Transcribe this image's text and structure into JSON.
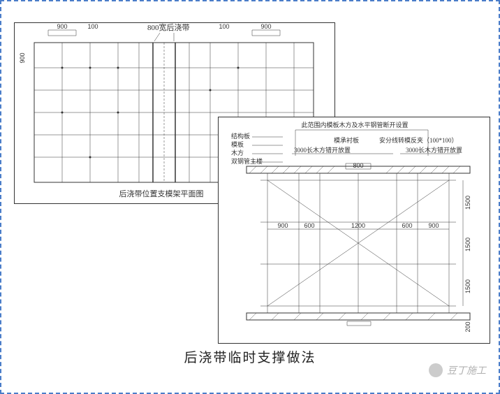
{
  "title": "后浇带临时支撑做法",
  "watermark": "豆丁施工",
  "plan": {
    "caption": "后浇带位置支模架平面图",
    "top_label": "800宽后浇带",
    "dims_top": [
      "900",
      "100",
      "100",
      "900"
    ],
    "dim_left": "900"
  },
  "elev": {
    "top_note": "此范围内模板木方及水平钢管断开设置",
    "callouts": [
      "模承衬板",
      "安分线转模反夹（100*100）",
      "3000长木方错开放置",
      "3000长木方错开放置"
    ],
    "legend": [
      "结构板",
      "模板",
      "木方",
      "双钢管主楼"
    ],
    "center_dim": "800",
    "dims_bottom": [
      "900",
      "600",
      "1200",
      "600",
      "900"
    ],
    "dims_right": [
      "1500",
      "1500",
      "1500"
    ],
    "dim_right_small": "200"
  }
}
